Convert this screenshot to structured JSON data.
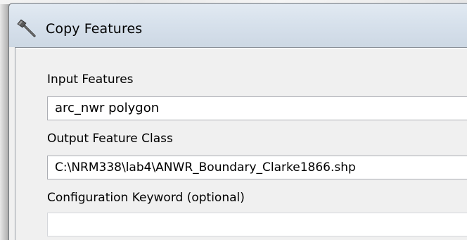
{
  "window": {
    "title": "Copy Features",
    "icon": "hammer-icon"
  },
  "form": {
    "input_features": {
      "label": "Input Features",
      "value": "arc_nwr polygon"
    },
    "output_feature_class": {
      "label": "Output Feature Class",
      "value": "C:\\NRM338\\lab4\\ANWR_Boundary_Clarke1866.shp"
    },
    "configuration_keyword": {
      "label": "Configuration Keyword (optional)",
      "value": ""
    }
  }
}
